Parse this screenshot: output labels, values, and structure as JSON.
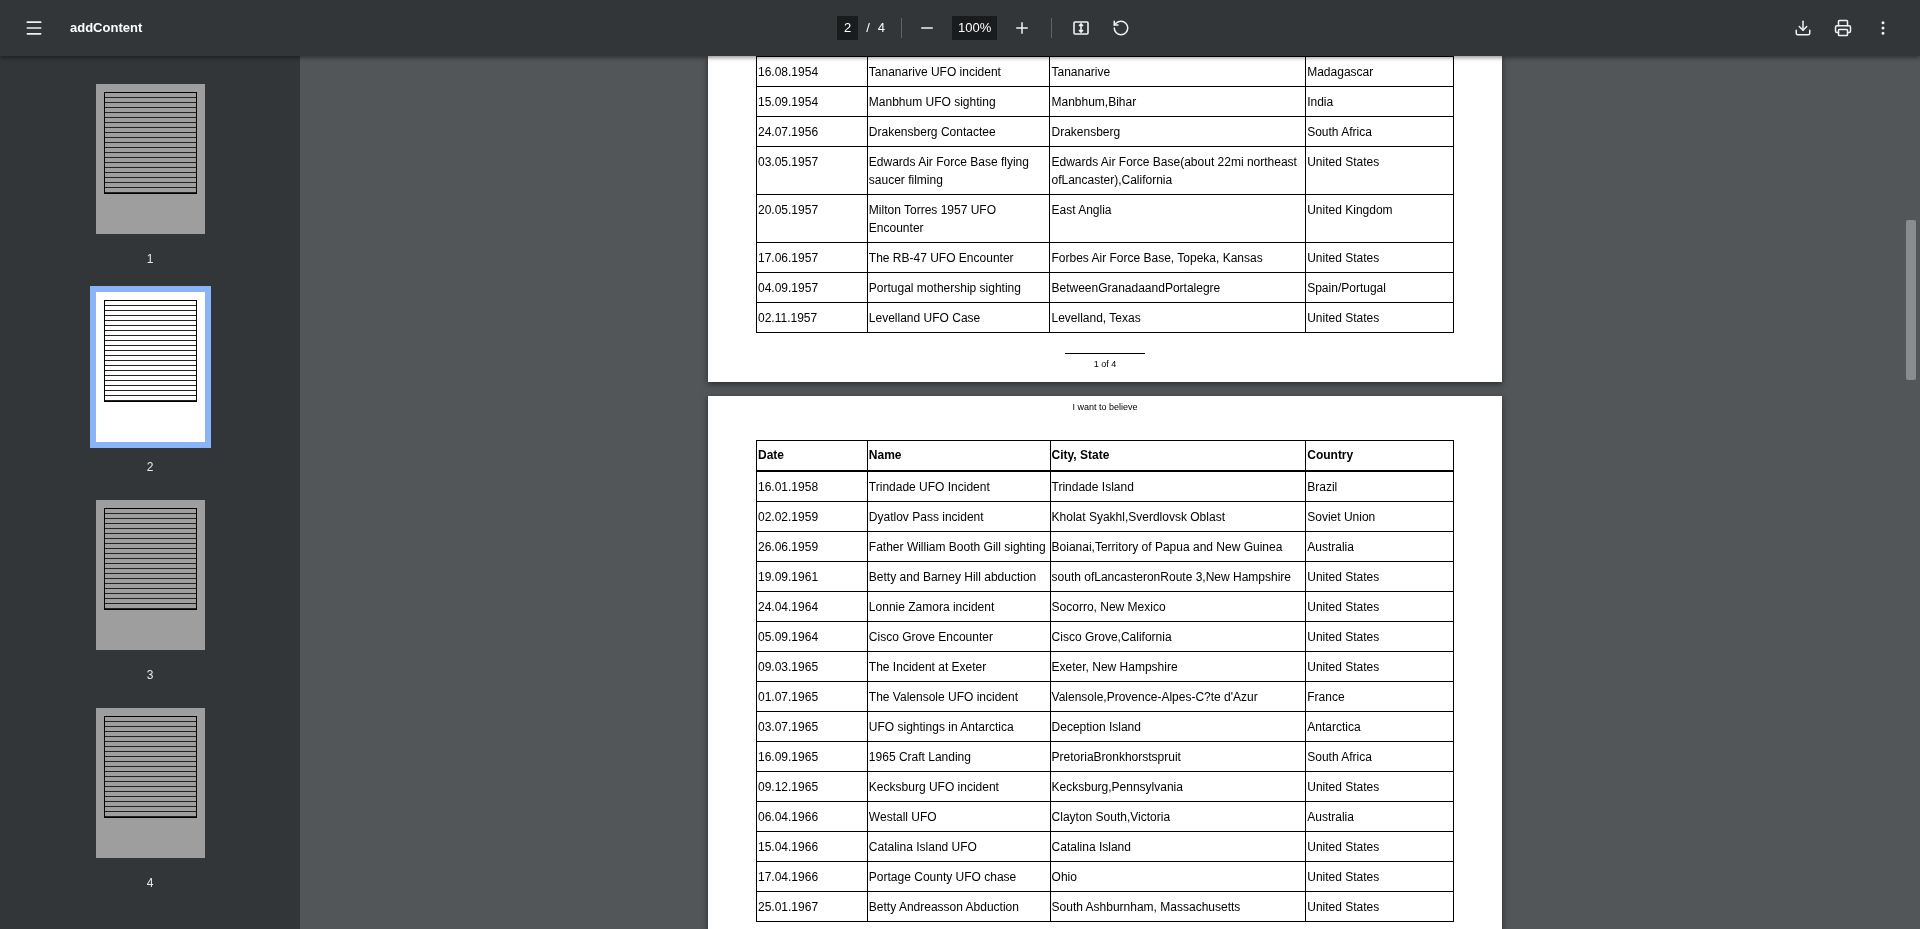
{
  "toolbar": {
    "title": "addContent",
    "page_input": "2",
    "page_separator": "/",
    "page_total": "4",
    "zoom": "100%"
  },
  "thumbnails": [
    {
      "label": "1",
      "selected": false
    },
    {
      "label": "2",
      "selected": true
    },
    {
      "label": "3",
      "selected": false
    },
    {
      "label": "4",
      "selected": false
    }
  ],
  "pages": [
    {
      "footer": "1 of 4",
      "rows": [
        [
          "16.08.1954",
          "Tananarive UFO incident",
          "Tananarive",
          "Madagascar"
        ],
        [
          "15.09.1954",
          "Manbhum UFO sighting",
          "Manbhum,Bihar",
          "India"
        ],
        [
          "24.07.1956",
          "Drakensberg Contactee",
          "Drakensberg",
          "South Africa"
        ],
        [
          "03.05.1957",
          "Edwards Air Force Base flying saucer filming",
          "Edwards Air Force Base(about 22mi northeast ofLancaster),California",
          "United States"
        ],
        [
          "20.05.1957",
          "Milton Torres 1957 UFO Encounter",
          "East Anglia",
          "United Kingdom"
        ],
        [
          "17.06.1957",
          "The RB-47 UFO Encounter",
          "Forbes Air Force Base, Topeka, Kansas",
          "United States"
        ],
        [
          "04.09.1957",
          "Portugal mothership sighting",
          "BetweenGranadaandPortalegre",
          "Spain/Portugal"
        ],
        [
          "02.11.1957",
          "Levelland UFO Case",
          "Levelland, Texas",
          "United States"
        ]
      ]
    },
    {
      "header": "I want to believe",
      "columns": [
        "Date",
        "Name",
        "City, State",
        "Country"
      ],
      "rows": [
        [
          "16.01.1958",
          "Trindade UFO Incident",
          "Trindade Island",
          "Brazil"
        ],
        [
          "02.02.1959",
          "Dyatlov Pass incident",
          "Kholat Syakhl,Sverdlovsk Oblast",
          "Soviet Union"
        ],
        [
          "26.06.1959",
          "Father William Booth Gill sighting",
          "Boianai,Territory of Papua and New Guinea",
          "Australia"
        ],
        [
          "19.09.1961",
          "Betty and Barney Hill abduction",
          "south ofLancasteronRoute 3,New Hampshire",
          "United States"
        ],
        [
          "24.04.1964",
          "Lonnie Zamora incident",
          "Socorro, New Mexico",
          "United States"
        ],
        [
          "05.09.1964",
          "Cisco Grove Encounter",
          "Cisco Grove,California",
          "United States"
        ],
        [
          "09.03.1965",
          "The Incident at Exeter",
          "Exeter, New Hampshire",
          "United States"
        ],
        [
          "01.07.1965",
          "The Valensole UFO incident",
          "Valensole,Provence-Alpes-C?te d'Azur",
          "France"
        ],
        [
          "03.07.1965",
          "UFO sightings in Antarctica",
          "Deception Island",
          "Antarctica"
        ],
        [
          "16.09.1965",
          "1965 Craft Landing",
          "PretoriaBronkhorstspruit",
          "South Africa"
        ],
        [
          "09.12.1965",
          "Kecksburg UFO incident",
          "Kecksburg,Pennsylvania",
          "United States"
        ],
        [
          "06.04.1966",
          "Westall UFO",
          "Clayton South,Victoria",
          "Australia"
        ],
        [
          "15.04.1966",
          "Catalina Island UFO",
          "Catalina Island",
          "United States"
        ],
        [
          "17.04.1966",
          "Portage County UFO chase",
          "Ohio",
          "United States"
        ],
        [
          "25.01.1967",
          "Betty Andreasson Abduction",
          "South Ashburnham, Massachusetts",
          "United States"
        ]
      ]
    }
  ]
}
